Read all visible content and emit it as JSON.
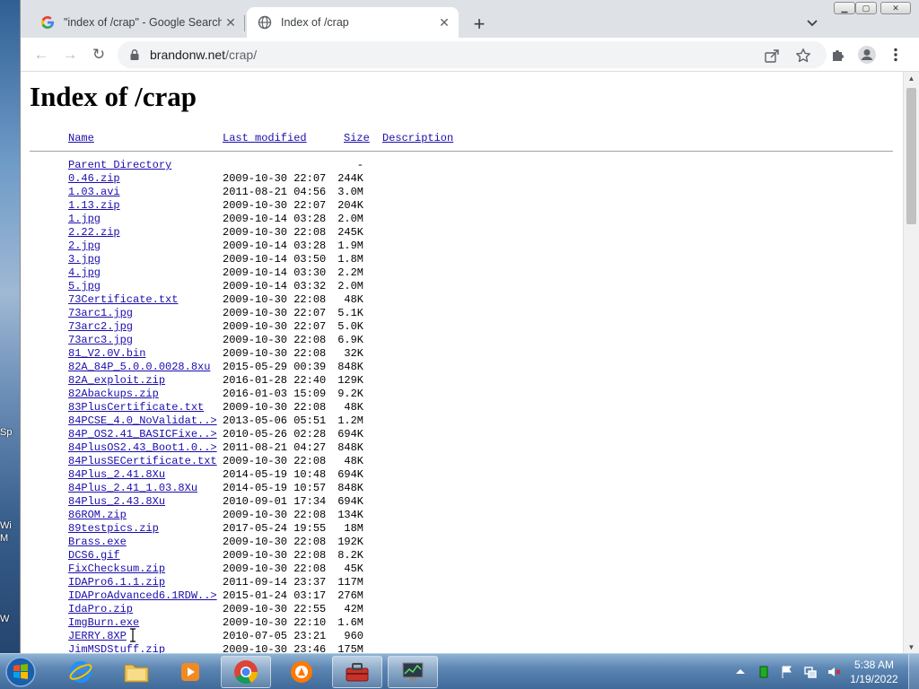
{
  "desktop": {
    "fragments": [
      "Sp",
      "Wi",
      "M",
      "W"
    ]
  },
  "tabs": [
    {
      "title": "\"index of /crap\" - Google Search",
      "close": "✕"
    },
    {
      "title": "Index of /crap",
      "close": "✕"
    }
  ],
  "tabstrip": {
    "new_tab": "+",
    "tab_search": "⌄"
  },
  "window_controls": {
    "minimize": "▁",
    "maximize": "▢",
    "close": "✕"
  },
  "toolbar": {
    "back": "←",
    "forward": "→",
    "reload": "↻",
    "url_host": "brandonw.net",
    "url_path": "/crap/"
  },
  "page": {
    "heading": "Index of /crap",
    "columns": {
      "name": "Name",
      "modified": "Last modified",
      "size": "Size",
      "description": "Description"
    },
    "rows": [
      {
        "name": "Parent Directory",
        "date": "",
        "size": "-"
      },
      {
        "name": "0.46.zip",
        "date": "2009-10-30 22:07",
        "size": "244K"
      },
      {
        "name": "1.03.avi",
        "date": "2011-08-21 04:56",
        "size": "3.0M"
      },
      {
        "name": "1.13.zip",
        "date": "2009-10-30 22:07",
        "size": "204K"
      },
      {
        "name": "1.jpg",
        "date": "2009-10-14 03:28",
        "size": "2.0M"
      },
      {
        "name": "2.22.zip",
        "date": "2009-10-30 22:08",
        "size": "245K"
      },
      {
        "name": "2.jpg",
        "date": "2009-10-14 03:28",
        "size": "1.9M"
      },
      {
        "name": "3.jpg",
        "date": "2009-10-14 03:50",
        "size": "1.8M"
      },
      {
        "name": "4.jpg",
        "date": "2009-10-14 03:30",
        "size": "2.2M"
      },
      {
        "name": "5.jpg",
        "date": "2009-10-14 03:32",
        "size": "2.0M"
      },
      {
        "name": "73Certificate.txt",
        "date": "2009-10-30 22:08",
        "size": "48K"
      },
      {
        "name": "73arc1.jpg",
        "date": "2009-10-30 22:07",
        "size": "5.1K"
      },
      {
        "name": "73arc2.jpg",
        "date": "2009-10-30 22:07",
        "size": "5.0K"
      },
      {
        "name": "73arc3.jpg",
        "date": "2009-10-30 22:08",
        "size": "6.9K"
      },
      {
        "name": "81_V2.0V.bin",
        "date": "2009-10-30 22:08",
        "size": "32K"
      },
      {
        "name": "82A_84P_5.0.0.0028.8xu",
        "date": "2015-05-29 00:39",
        "size": "848K"
      },
      {
        "name": "82A_exploit.zip",
        "date": "2016-01-28 22:40",
        "size": "129K"
      },
      {
        "name": "82Abackups.zip",
        "date": "2016-01-03 15:09",
        "size": "9.2K"
      },
      {
        "name": "83PlusCertificate.txt",
        "date": "2009-10-30 22:08",
        "size": "48K"
      },
      {
        "name": "84PCSE_4.0_NoValidat..>",
        "date": "2013-05-06 05:51",
        "size": "1.2M"
      },
      {
        "name": "84P_OS2.41_BASICFixe..>",
        "date": "2010-05-26 02:28",
        "size": "694K"
      },
      {
        "name": "84PlusOS2.43_Boot1.0..>",
        "date": "2011-08-21 04:27",
        "size": "848K"
      },
      {
        "name": "84PlusSECertificate.txt",
        "date": "2009-10-30 22:08",
        "size": "48K"
      },
      {
        "name": "84Plus_2.41.8Xu",
        "date": "2014-05-19 10:48",
        "size": "694K"
      },
      {
        "name": "84Plus_2.41_1.03.8Xu",
        "date": "2014-05-19 10:57",
        "size": "848K"
      },
      {
        "name": "84Plus_2.43.8Xu",
        "date": "2010-09-01 17:34",
        "size": "694K"
      },
      {
        "name": "86ROM.zip",
        "date": "2009-10-30 22:08",
        "size": "134K"
      },
      {
        "name": "89testpics.zip",
        "date": "2017-05-24 19:55",
        "size": "18M"
      },
      {
        "name": "Brass.exe",
        "date": "2009-10-30 22:08",
        "size": "192K"
      },
      {
        "name": "DCS6.gif",
        "date": "2009-10-30 22:08",
        "size": "8.2K"
      },
      {
        "name": "FixChecksum.zip",
        "date": "2009-10-30 22:08",
        "size": "45K"
      },
      {
        "name": "IDAPro6.1.1.zip",
        "date": "2011-09-14 23:37",
        "size": "117M"
      },
      {
        "name": "IDAProAdvanced6.1RDW..>",
        "date": "2015-01-24 03:17",
        "size": "276M"
      },
      {
        "name": "IdaPro.zip",
        "date": "2009-10-30 22:55",
        "size": "42M"
      },
      {
        "name": "ImgBurn.exe",
        "date": "2009-10-30 22:10",
        "size": "1.6M"
      },
      {
        "name": "JERRY.8XP",
        "date": "2010-07-05 23:21",
        "size": "960"
      },
      {
        "name": "JimMSDStuff.zip",
        "date": "2009-10-30 23:46",
        "size": "175M"
      }
    ]
  },
  "taskbar": {
    "apps": [
      "internet-explorer",
      "file-explorer",
      "media-player",
      "chrome",
      "avast",
      "toolbox",
      "network-monitor"
    ],
    "clock_time": "5:38 AM",
    "clock_date": "1/19/2022"
  },
  "colors": {
    "link": "#1a0dab",
    "tabstrip": "#dee1e6",
    "taskbar": "#5c86b3"
  }
}
